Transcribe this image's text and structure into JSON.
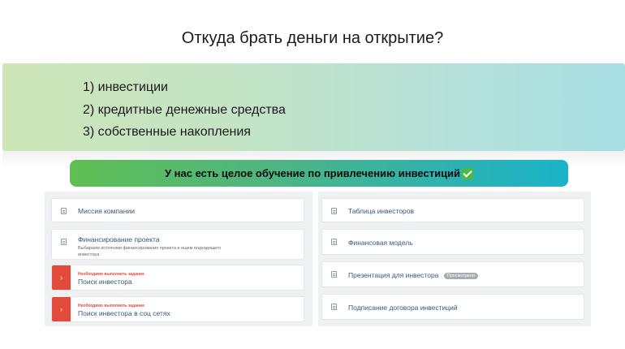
{
  "title": "Откуда брать деньги на открытие?",
  "sources": [
    "1) инвестиции",
    "2) кредитные денежные средства",
    "3) собственные накопления"
  ],
  "banner": {
    "text": "У нас есть целое обучение по привлечению инвестиций",
    "icon": "check-mark-icon"
  },
  "lessons_left": [
    {
      "label": "Миссия компании"
    },
    {
      "label": "Финансирование проекта",
      "description": "Выбираем источники финансирования проекта и ищем подходящего инвестора"
    },
    {
      "label": "Поиск инвестора",
      "warning": "Необходимо выполнить задание"
    },
    {
      "label": "Поиск инвестора в соц сетях",
      "warning": "Необходимо выполнить задание"
    }
  ],
  "lessons_right": [
    {
      "label": "Таблица инвесторов"
    },
    {
      "label": "Финансовая модель"
    },
    {
      "label": "Презентация для инвестора",
      "badge": "Просмотрено"
    },
    {
      "label": "Подписание договора инвестиций"
    }
  ],
  "colors": {
    "task_red": "#e24b3b",
    "banner_start": "#5fbf52",
    "banner_end": "#1ab3c9"
  }
}
